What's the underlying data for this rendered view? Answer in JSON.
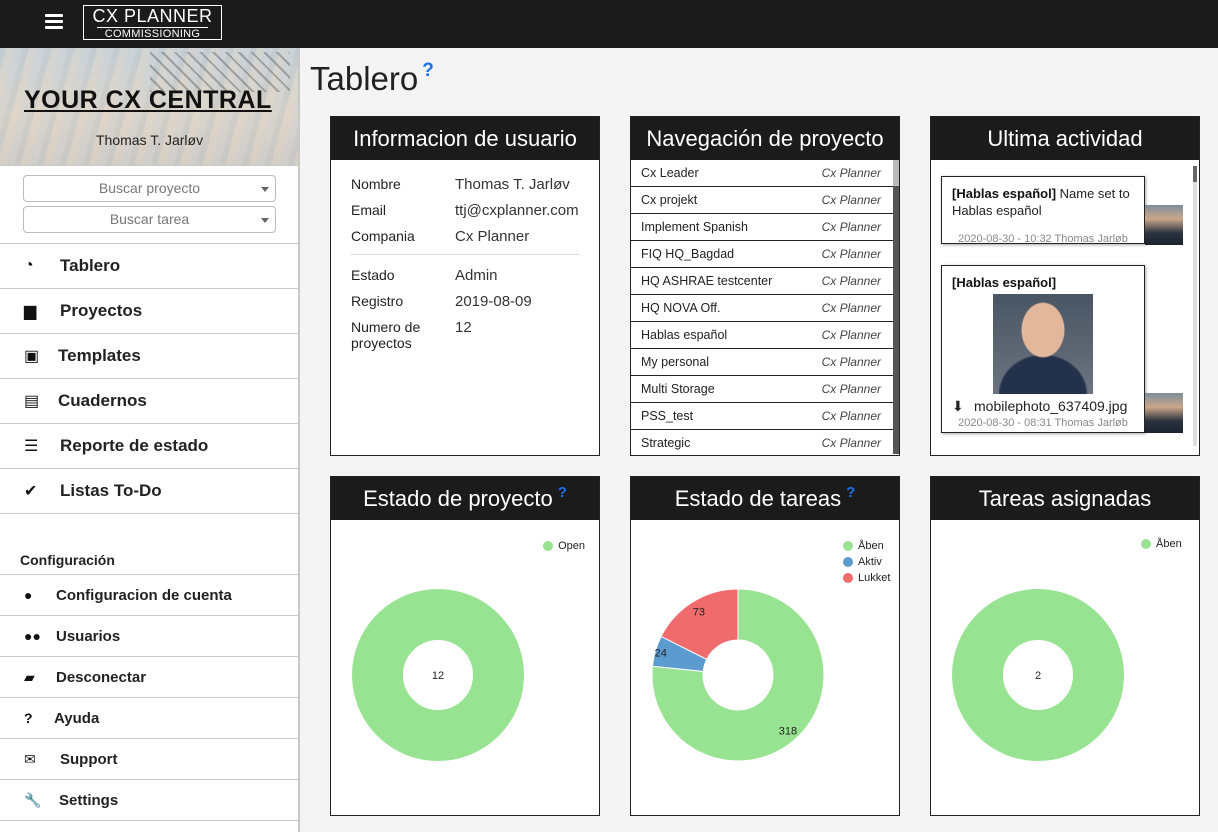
{
  "topbar": {
    "logo_line1": "CX PLANNER",
    "logo_line2": "COMMISSIONING"
  },
  "sidebar": {
    "banner_title": "YOUR CX CENTRAL",
    "banner_user": "Thomas T. Jarløv",
    "search_project_placeholder": "Buscar proyecto",
    "search_task_placeholder": "Buscar tarea",
    "nav": [
      {
        "label": "Tablero",
        "icon": "dashboard-icon"
      },
      {
        "label": "Proyectos",
        "icon": "briefcase-icon"
      },
      {
        "label": "Templates",
        "icon": "save-icon"
      },
      {
        "label": "Cuadernos",
        "icon": "document-icon"
      },
      {
        "label": "Reporte de estado",
        "icon": "list-icon"
      },
      {
        "label": "Listas To-Do",
        "icon": "checkmark-icon"
      }
    ],
    "config_heading": "Configuración",
    "config": [
      {
        "label": "Configuracion de cuenta",
        "icon": "user-icon"
      },
      {
        "label": "Usuarios",
        "icon": "users-icon"
      },
      {
        "label": "Desconectar",
        "icon": "lock-icon"
      },
      {
        "label": "Ayuda",
        "icon": "question-icon"
      },
      {
        "label": "Support",
        "icon": "envelope-icon"
      },
      {
        "label": "Settings",
        "icon": "wrench-icon"
      }
    ]
  },
  "page": {
    "title": "Tablero",
    "help": "?"
  },
  "user_info": {
    "title": "Informacion de usuario",
    "rows": [
      {
        "k": "Nombre",
        "v": "Thomas T. Jarløv"
      },
      {
        "k": "Email",
        "v": "ttj@cxplanner.com"
      },
      {
        "k": "Compania",
        "v": "Cx Planner"
      }
    ],
    "rows2": [
      {
        "k": "Estado",
        "v": "Admin"
      },
      {
        "k": "Registro",
        "v": "2019-08-09"
      },
      {
        "k": "Numero de proyectos",
        "v": "12"
      }
    ]
  },
  "project_nav": {
    "title": "Navegación de proyecto",
    "items": [
      {
        "name": "Cx Leader",
        "org": "Cx Planner"
      },
      {
        "name": "Cx projekt",
        "org": "Cx Planner"
      },
      {
        "name": "Implement Spanish",
        "org": "Cx Planner"
      },
      {
        "name": "FIQ HQ_Bagdad",
        "org": "Cx Planner"
      },
      {
        "name": "HQ ASHRAE testcenter",
        "org": "Cx Planner"
      },
      {
        "name": "HQ NOVA Off.",
        "org": "Cx Planner"
      },
      {
        "name": "Hablas español",
        "org": "Cx Planner"
      },
      {
        "name": "My personal",
        "org": "Cx Planner"
      },
      {
        "name": "Multi Storage",
        "org": "Cx Planner"
      },
      {
        "name": "PSS_test",
        "org": "Cx Planner"
      },
      {
        "name": "Strategic",
        "org": "Cx Planner"
      }
    ]
  },
  "activity": {
    "title": "Ultima actividad",
    "items": [
      {
        "tag": "[Hablas español]",
        "text": " Name set to Hablas español",
        "meta": "2020-08-30 - 10:32 Thomas Jarløb"
      },
      {
        "tag": "[Hablas español]",
        "file": "mobilephoto_637409.jpg",
        "meta": "2020-08-30 - 08:31 Thomas Jarløb"
      }
    ]
  },
  "chart_data": [
    {
      "type": "pie",
      "title": "Estado de proyecto",
      "categories": [
        "Open"
      ],
      "values": [
        12
      ],
      "colors": [
        "#98e391"
      ],
      "center_label": "12",
      "legend": "top-right"
    },
    {
      "type": "pie",
      "title": "Estado de tareas",
      "categories": [
        "Åben",
        "Aktiv",
        "Lukket"
      ],
      "values": [
        318,
        24,
        73
      ],
      "colors": [
        "#98e391",
        "#5b9bd0",
        "#f06b6b"
      ],
      "legend": "top-right"
    },
    {
      "type": "pie",
      "title": "Tareas asignadas",
      "categories": [
        "Åben"
      ],
      "values": [
        2
      ],
      "colors": [
        "#98e391"
      ],
      "center_label": "2",
      "legend": "top-right"
    }
  ]
}
